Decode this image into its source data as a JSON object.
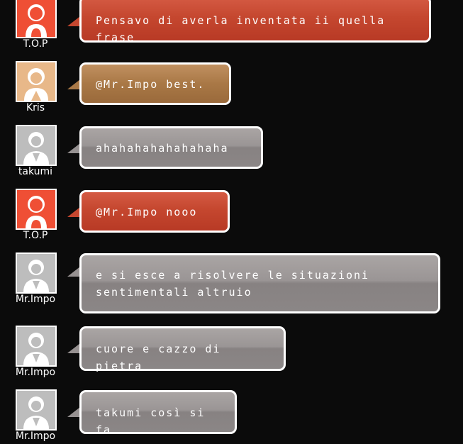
{
  "messages": [
    {
      "user": "T.O.P",
      "avatar": "top-avatar-icon",
      "text": "Pensavo di averla inventata ii quella frase",
      "color": "#c5472f"
    },
    {
      "user": "Kris",
      "avatar": "kris-avatar-icon",
      "text": "@Mr.Impo best.",
      "color": "#a97846"
    },
    {
      "user": "takumi",
      "avatar": "default-user-avatar-icon",
      "text": "ahahahahahahahaha",
      "color": "#969191"
    },
    {
      "user": "T.O.P",
      "avatar": "top-avatar-icon",
      "text": "@Mr.Impo nooo",
      "color": "#c5472f"
    },
    {
      "user": "Mr.Impo",
      "avatar": "default-user-avatar-icon",
      "text": "e si esce a risolvere le situazioni sentimentali altruio",
      "color": "#969191"
    },
    {
      "user": "Mr.Impo",
      "avatar": "default-user-avatar-icon",
      "text": "cuore e cazzo di pietra",
      "color": "#969191"
    },
    {
      "user": "Mr.Impo",
      "avatar": "default-user-avatar-icon",
      "text": "takumi così si fa",
      "color": "#969191"
    }
  ]
}
